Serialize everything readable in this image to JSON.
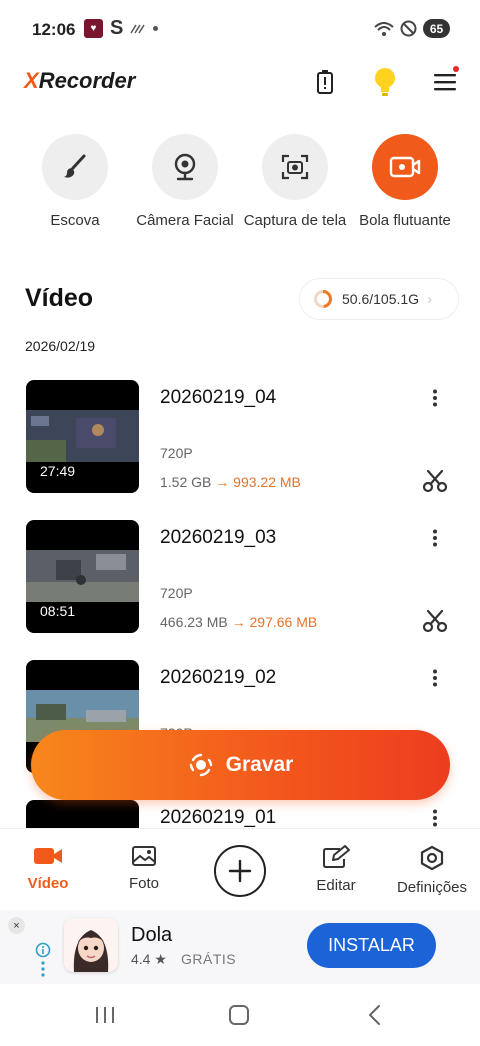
{
  "status_bar": {
    "time": "12:06",
    "left_icons": [
      "app-notification-icon",
      "s-icon",
      "signal-slash-icon",
      "dot-icon"
    ],
    "battery": "65",
    "right_icons": [
      "wifi-icon",
      "do-not-disturb-icon",
      "battery-icon"
    ]
  },
  "app_bar": {
    "logo_x": "X",
    "logo_rest": "Recorder",
    "icons": [
      "battery-alert-icon",
      "lightbulb-icon",
      "menu-icon"
    ],
    "accent_color": "#f05a1a"
  },
  "tools": [
    {
      "label": "Escova",
      "icon": "brush-icon",
      "active": false
    },
    {
      "label": "Câmera Facial",
      "icon": "webcam-icon",
      "active": false
    },
    {
      "label": "Captura de tela",
      "icon": "screenshot-camera-icon",
      "active": false
    },
    {
      "label": "Bola flutuante",
      "icon": "floating-ball-icon",
      "active": true
    }
  ],
  "main": {
    "section_title": "Vídeo",
    "storage": "50.6/105.1G",
    "storage_fraction": 0.48,
    "date": "2026/02/19"
  },
  "videos": [
    {
      "title": "20260219_04",
      "duration": "27:49",
      "resolution": "720P",
      "size": "1.52 GB",
      "arrow": "→",
      "compressed": "993.22 MB"
    },
    {
      "title": "20260219_03",
      "duration": "08:51",
      "resolution": "720P",
      "size": "466.23 MB",
      "arrow": "→",
      "compressed": "297.66 MB"
    },
    {
      "title": "20260219_02",
      "duration": "",
      "resolution": "720P",
      "size": "",
      "arrow": "",
      "compressed": ""
    },
    {
      "title": "20260219_01",
      "duration": "",
      "resolution": "",
      "size": "",
      "arrow": "",
      "compressed": ""
    }
  ],
  "record_button": {
    "label": "Gravar"
  },
  "bottom_nav": [
    {
      "label": "Vídeo",
      "icon": "video-camera-icon",
      "active": true
    },
    {
      "label": "Foto",
      "icon": "photo-icon",
      "active": false
    },
    {
      "label": "",
      "icon": "plus-circle-icon",
      "active": false
    },
    {
      "label": "Editar",
      "icon": "edit-icon",
      "active": false
    },
    {
      "label": "Definições",
      "icon": "settings-icon",
      "active": false
    }
  ],
  "ad": {
    "close": "×",
    "app_name": "Dola",
    "rating": "4.4 ★",
    "price": "GRÁTIS",
    "install_label": "INSTALAR"
  },
  "system_nav": [
    "recents-icon",
    "home-icon",
    "back-icon"
  ]
}
